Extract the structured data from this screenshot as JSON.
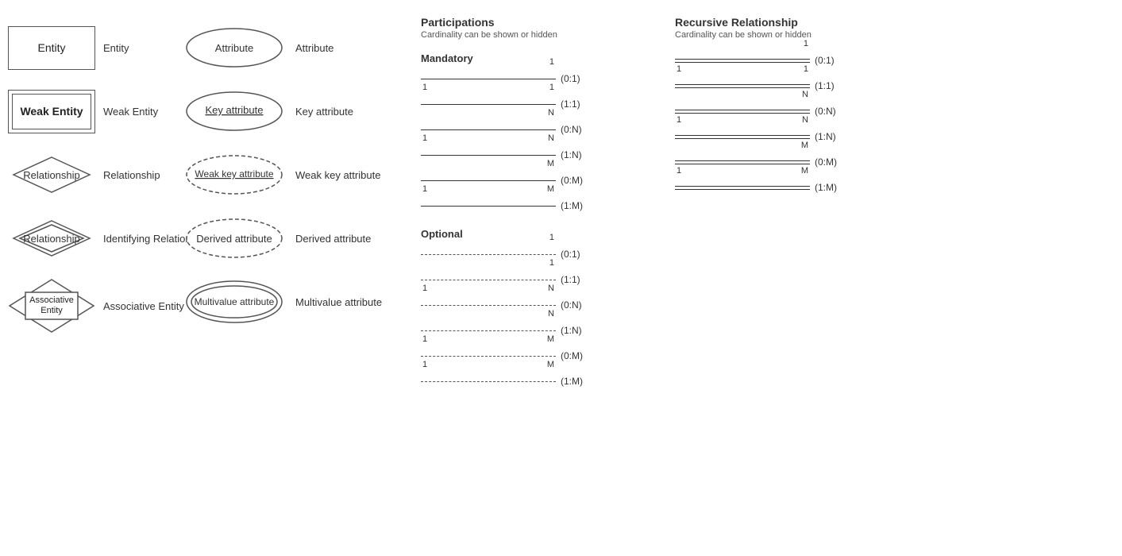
{
  "shapes": {
    "entity": {
      "shape_label": "Entity",
      "text_label": "Entity",
      "inner_text": "Entity"
    },
    "weak_entity": {
      "shape_label": "Weak Entity",
      "text_label": "Weak Entity",
      "inner_text": "Weak Entity"
    },
    "relationship": {
      "shape_label": "Relationship",
      "text_label": "Relationship",
      "inner_text": "Relationship"
    },
    "identifying_relationship": {
      "shape_label": "Identifying Relationship",
      "text_label": "Identifying Relationship",
      "inner_text": "Relationship"
    },
    "associative_entity": {
      "shape_label": "Associative Entity",
      "text_label": "Associative Entity",
      "inner_text": "Associative Entity"
    }
  },
  "attributes": {
    "attribute": {
      "ellipse_label": "Attribute",
      "text_label": "Attribute",
      "inner_text": "Attribute",
      "underline": false,
      "dashed": false,
      "double": false
    },
    "key_attribute": {
      "ellipse_label": "Key attribute",
      "text_label": "Key attribute",
      "inner_text": "Key attribute",
      "underline": true,
      "dashed": false,
      "double": false
    },
    "weak_key_attribute": {
      "ellipse_label": "Weak key attribute",
      "text_label": "Weak key attribute",
      "inner_text": "Weak key attribute",
      "underline": true,
      "dashed": true,
      "double": false
    },
    "derived_attribute": {
      "ellipse_label": "Derived attribute",
      "text_label": "Derived attribute",
      "inner_text": "Derived attribute",
      "underline": false,
      "dashed": true,
      "double": false
    },
    "multivalue_attribute": {
      "ellipse_label": "Multivalue attribute",
      "text_label": "Multivalue attribute",
      "inner_text": "Multivalue attribute",
      "underline": false,
      "dashed": false,
      "double": true
    }
  },
  "participations": {
    "title": "Participations",
    "subtitle": "Cardinality can be shown or hidden",
    "mandatory_label": "Mandatory",
    "optional_label": "Optional",
    "rows_mandatory": [
      {
        "left": "",
        "right": "1",
        "cardinality": "(0:1)"
      },
      {
        "left": "1",
        "right": "1",
        "cardinality": "(1:1)"
      },
      {
        "left": "",
        "right": "N",
        "cardinality": "(0:N)"
      },
      {
        "left": "1",
        "right": "N",
        "cardinality": "(1:N)"
      },
      {
        "left": "",
        "right": "M",
        "cardinality": "(0:M)"
      },
      {
        "left": "1",
        "right": "M",
        "cardinality": "(1:M)"
      }
    ],
    "rows_optional": [
      {
        "left": "",
        "right": "1",
        "cardinality": "(0:1)"
      },
      {
        "left": "",
        "right": "1",
        "cardinality": "(1:1)"
      },
      {
        "left": "1",
        "right": "N",
        "cardinality": "(0:N)"
      },
      {
        "left": "",
        "right": "N",
        "cardinality": "(1:N)"
      },
      {
        "left": "1",
        "right": "M",
        "cardinality": "(0:M)"
      },
      {
        "left": "1",
        "right": "M",
        "cardinality": "(1:M)"
      }
    ]
  },
  "recursive": {
    "title": "Recursive Relationship",
    "subtitle": "Cardinality can be shown or hidden",
    "rows": [
      {
        "left": "",
        "right": "1",
        "cardinality": "(0:1)"
      },
      {
        "left": "1",
        "right": "1",
        "cardinality": "(1:1)"
      },
      {
        "left": "",
        "right": "N",
        "cardinality": "(0:N)"
      },
      {
        "left": "1",
        "right": "N",
        "cardinality": "(1:N)"
      },
      {
        "left": "",
        "right": "M",
        "cardinality": "(0:M)"
      },
      {
        "left": "1",
        "right": "M",
        "cardinality": "(1:M)"
      }
    ]
  }
}
